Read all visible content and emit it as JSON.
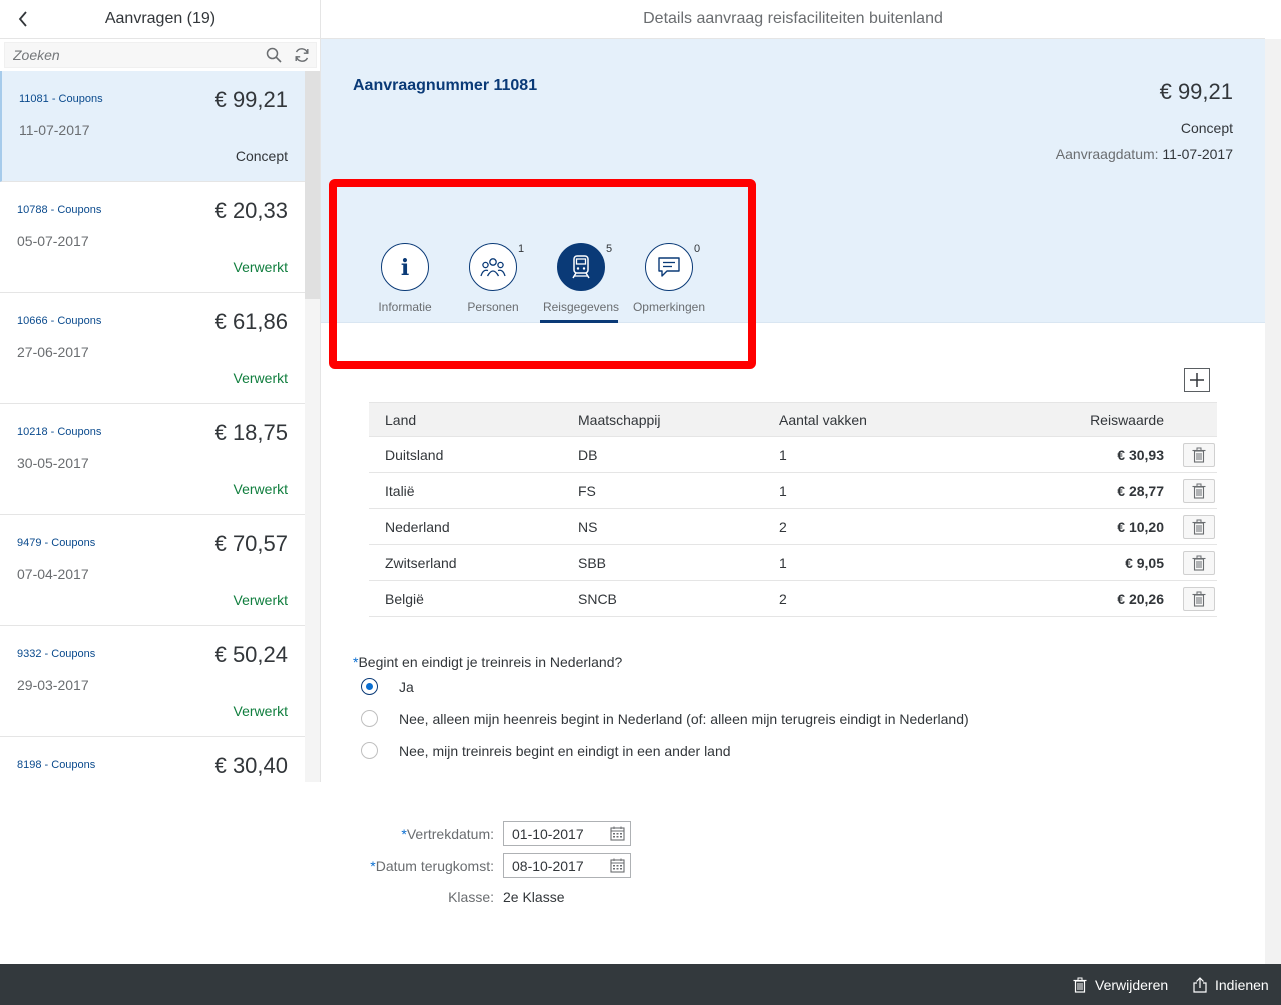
{
  "master": {
    "title": "Aanvragen (19)",
    "search_placeholder": "Zoeken",
    "items": [
      {
        "id": "11081 - Coupons",
        "amount": "€ 99,21",
        "date": "11-07-2017",
        "status": "Concept"
      },
      {
        "id": "10788 - Coupons",
        "amount": "€ 20,33",
        "date": "05-07-2017",
        "status": "Verwerkt"
      },
      {
        "id": "10666 - Coupons",
        "amount": "€ 61,86",
        "date": "27-06-2017",
        "status": "Verwerkt"
      },
      {
        "id": "10218 - Coupons",
        "amount": "€ 18,75",
        "date": "30-05-2017",
        "status": "Verwerkt"
      },
      {
        "id": "9479 - Coupons",
        "amount": "€ 70,57",
        "date": "07-04-2017",
        "status": "Verwerkt"
      },
      {
        "id": "9332 - Coupons",
        "amount": "€ 50,24",
        "date": "29-03-2017",
        "status": "Verwerkt"
      },
      {
        "id": "8198 - Coupons",
        "amount": "€ 30,40",
        "date": "",
        "status": ""
      }
    ]
  },
  "detail": {
    "page_title": "Details aanvraag reisfaciliteiten buitenland",
    "header": {
      "title": "Aanvraagnummer 11081",
      "amount": "€ 99,21",
      "status": "Concept",
      "date_label": "Aanvraagdatum:",
      "date_value": "11-07-2017"
    },
    "tabs": [
      {
        "label": "Informatie",
        "count": "",
        "icon": "info-icon"
      },
      {
        "label": "Personen",
        "count": "1",
        "icon": "group-icon"
      },
      {
        "label": "Reisgegevens",
        "count": "5",
        "icon": "train-icon"
      },
      {
        "label": "Opmerkingen",
        "count": "0",
        "icon": "comment-icon"
      }
    ],
    "active_tab": "Reisgegevens",
    "table": {
      "columns": [
        "Land",
        "Maatschappij",
        "Aantal vakken",
        "Reiswaarde"
      ],
      "rows": [
        [
          "Duitsland",
          "DB",
          "1",
          "€ 30,93"
        ],
        [
          "Italië",
          "FS",
          "1",
          "€ 28,77"
        ],
        [
          "Nederland",
          "NS",
          "2",
          "€ 10,20"
        ],
        [
          "Zwitserland",
          "SBB",
          "1",
          "€ 9,05"
        ],
        [
          "België",
          "SNCB",
          "2",
          "€ 20,26"
        ]
      ]
    },
    "question": {
      "required_mark": "*",
      "text": "Begint en eindigt je treinreis in Nederland?",
      "options": [
        "Ja",
        "Nee, alleen mijn heenreis begint in Nederland (of: alleen mijn terugreis eindigt in Nederland)",
        "Nee, mijn treinreis begint en eindigt in een ander land"
      ],
      "selected": "Ja"
    },
    "form": {
      "departure_label": "Vertrekdatum:",
      "departure_value": "01-10-2017",
      "return_label": "Datum terugkomst:",
      "return_value": "08-10-2017",
      "class_label": "Klasse:",
      "class_value": "2e Klasse"
    }
  },
  "footer": {
    "delete_label": "Verwijderen",
    "submit_label": "Indienen"
  },
  "colors": {
    "brand": "#0a3a77",
    "processed": "#107e3e",
    "highlight": "#ff0000",
    "footer_bg": "#33393d",
    "header_bg": "#e5f0fa"
  }
}
